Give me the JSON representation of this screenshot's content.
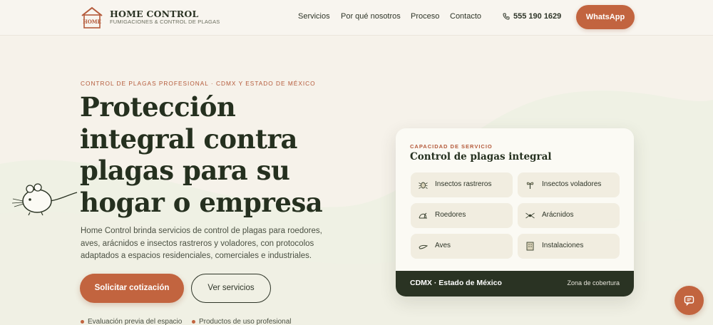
{
  "header": {
    "brand_title": "HOME CONTROL",
    "brand_subtitle": "FUMIGACIONES & CONTROL DE PLAGAS",
    "logo_text": "HOME",
    "nav": [
      "Servicios",
      "Por qué nosotros",
      "Proceso",
      "Contacto"
    ],
    "phone": "555 190 1629",
    "whatsapp_label": "WhatsApp"
  },
  "hero": {
    "eyebrow": "CONTROL DE PLAGAS PROFESIONAL · CDMX Y ESTADO DE MÉXICO",
    "title": "Protección integral contra plagas para su hogar o empresa",
    "description": "Home Control brinda servicios de control de plagas para roedores, aves, arácnidos e insectos rastreros y voladores, con protocolos adaptados a espacios residenciales, comerciales e industriales.",
    "primary_cta": "Solicitar cotización",
    "secondary_cta": "Ver servicios",
    "bullets": [
      "Evaluación previa del espacio",
      "Productos de uso profesional"
    ]
  },
  "card": {
    "eyebrow": "CAPACIDAD DE SERVICIO",
    "title": "Control de plagas integral",
    "services": [
      {
        "label": "Insectos rastreros",
        "icon": "crawling-insect-icon"
      },
      {
        "label": "Insectos voladores",
        "icon": "flying-insect-icon"
      },
      {
        "label": "Roedores",
        "icon": "rodent-icon"
      },
      {
        "label": "Arácnidos",
        "icon": "spider-icon"
      },
      {
        "label": "Aves",
        "icon": "bird-icon"
      },
      {
        "label": "Instalaciones",
        "icon": "building-icon"
      }
    ],
    "footer_location": "CDMX · Estado de México",
    "footer_caption": "Zona de cobertura"
  },
  "colors": {
    "accent": "#c2643f",
    "dark": "#2a3323",
    "background": "#f6f2ea"
  }
}
